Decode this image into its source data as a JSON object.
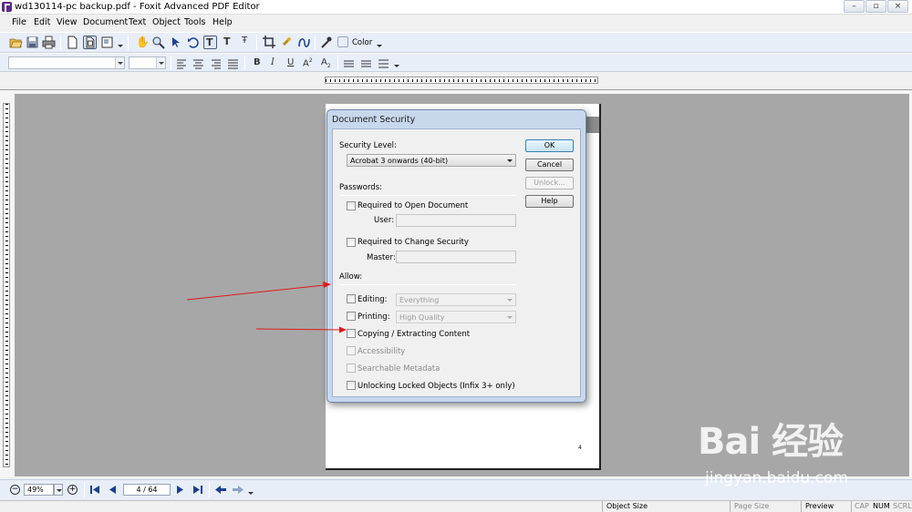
{
  "window": {
    "title": "wd130114-pc backup.pdf - Foxit Advanced PDF Editor",
    "controls": [
      "minimize",
      "maximize",
      "close"
    ]
  },
  "menu": [
    "File",
    "Edit",
    "View",
    "Document",
    "Text",
    "Object",
    "Tools",
    "Help"
  ],
  "toolbar": {
    "color_label": "Color",
    "icons": [
      "open-folder-icon",
      "save-icon",
      "print-icon",
      "page-icon",
      "fit-page-icon",
      "page-view-icon",
      "hand-icon",
      "zoom-icon",
      "select-arrow-icon",
      "undo-icon",
      "text-tool-icon",
      "text-edit-icon",
      "text-format-icon",
      "crop-icon",
      "link-icon",
      "curve-icon",
      "eyedropper-icon"
    ]
  },
  "format_toolbar": {
    "font_name": "",
    "font_size": "",
    "icons": [
      "align-left-icon",
      "align-center-icon",
      "align-right-icon",
      "justify-icon",
      "bold-icon",
      "italic-icon",
      "underline-icon",
      "superscript-icon",
      "subscript-icon",
      "list-icon",
      "list2-icon",
      "list3-icon"
    ]
  },
  "document": {
    "page_number_on_page": "4"
  },
  "dialog": {
    "title": "Document Security",
    "security_level_label": "Security Level:",
    "security_level_value": "Acrobat 3 onwards (40-bit)",
    "passwords_section": "Passwords:",
    "open_doc_label": "Required to Open Document",
    "user_label": "User:",
    "user_value": "",
    "change_security_label": "Required to Change Security",
    "master_label": "Master:",
    "master_value": "",
    "allow_section": "Allow:",
    "editing_label": "Editing:",
    "editing_value": "Everything",
    "printing_label": "Printing:",
    "printing_value": "High Quality",
    "copying_label": "Copying / Extracting Content",
    "accessibility_label": "Accessibility",
    "metadata_label": "Searchable Metadata",
    "unlocking_label": "Unlocking Locked Objects (Infix 3+ only)",
    "buttons": {
      "ok": "OK",
      "cancel": "Cancel",
      "unlock": "Unlock...",
      "help": "Help"
    },
    "checkboxes_checked": {
      "open_doc": false,
      "change_security": false,
      "editing": false,
      "printing": false,
      "copying": false,
      "accessibility": false,
      "metadata": false,
      "unlocking": false
    }
  },
  "navigation": {
    "zoom": "49%",
    "page": "4 / 64"
  },
  "status": {
    "object_size": "Object Size",
    "page_size": "Page Size",
    "preview": "Preview",
    "cap": "CAP",
    "num": "NUM",
    "scrl": "SCRL"
  },
  "watermark": {
    "logo": "Bai 经验",
    "url": "jingyan.baidu.com"
  },
  "colors": {
    "annotation_arrow": "#e11a1a",
    "canvas": "#a7a7a7",
    "dialog_frame": "#c7d8ed"
  }
}
